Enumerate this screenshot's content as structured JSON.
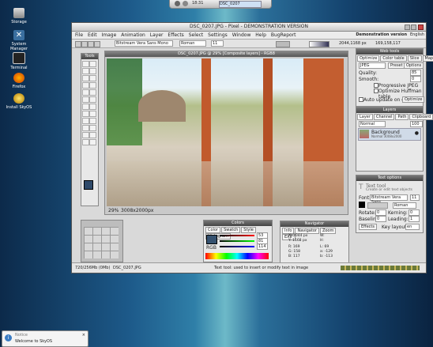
{
  "desktop": {
    "icons": [
      {
        "label": "Storage"
      },
      {
        "label": "System Manager"
      },
      {
        "label": "Terminal"
      },
      {
        "label": "Firefox"
      },
      {
        "label": "Install SkyOS"
      }
    ]
  },
  "dock": {
    "clock": "18:31",
    "task": "DSC_0207"
  },
  "window": {
    "title": "DSC_0207.JPG - Pixel - DEMONSTRATION VERSION",
    "menu": [
      "File",
      "Edit",
      "Image",
      "Animation",
      "Layer",
      "Effects",
      "Select",
      "Settings",
      "Window",
      "Help",
      "BugReport"
    ],
    "demo_label": "Demonstration version",
    "language": "English",
    "font_name": "Bitstream Vera Sans Mono",
    "font_style": "Roman",
    "font_size": "11",
    "coords": "2044,1168 px",
    "color_values": "169,158,117"
  },
  "tools": {
    "title": "Tools"
  },
  "doc": {
    "title": "DSC_0207.JPG @ 29% [Composite layers] - RGB8",
    "zoom": "29%",
    "size": "3008x2000px"
  },
  "colors_panel": {
    "title": "Colors",
    "tabs": [
      "Color",
      "Swatch",
      "Style",
      "Histogram"
    ],
    "r": "53",
    "g": "81",
    "b": "114",
    "mode": "RGB"
  },
  "navigator": {
    "title": "Navigator",
    "tabs": [
      "Info",
      "Navigator",
      "Zoom",
      "EXIF"
    ],
    "x": "X: 2044 px",
    "y": "Y: 1168 px",
    "r": "R: 169",
    "g": "G: 158",
    "b": "B: 117",
    "w": "W:",
    "h": "H:",
    "l": "L: 69",
    "a": "a: -129",
    "bb": "b: -113"
  },
  "webtools": {
    "title": "Web tools",
    "tabs": [
      "Optimize",
      "Color table",
      "Slice",
      "Map"
    ],
    "format": "JPEG",
    "preset": "Preset",
    "options": "Options",
    "quality_label": "Quality:",
    "quality": "85",
    "smooth_label": "Smooth:",
    "smooth": "0",
    "progressive": "Progressive JPEG",
    "huffman": "Optimize Huffman table",
    "auto_update": "Auto update on change",
    "optimize": "Optimize"
  },
  "layers": {
    "title": "Layers",
    "tabs": [
      "Layer",
      "Channel",
      "Path",
      "Clipboard"
    ],
    "mode": "Normal",
    "opacity": "100",
    "layer_name": "Background",
    "layer_info": "Normal 3008x2000"
  },
  "textopts": {
    "title": "Text options",
    "tool_name": "Text tool",
    "tool_desc": "Create or edit text objects",
    "font_label": "Font:",
    "font": "Bitstream Vera Sans",
    "size": "11",
    "style": "Roman",
    "rotate_label": "Rotate:",
    "rotate": "0",
    "kerning_label": "Kerning:",
    "kerning": "0",
    "baseline_label": "Baseline:",
    "baseline": "0",
    "leading_label": "Leading:",
    "leading": "1",
    "effects": "Effects",
    "keylayout_label": "Key layout:",
    "keylayout": "en"
  },
  "status": {
    "mem": "720/256Mb (0Mb)",
    "file": "DSC_0207.JPG",
    "hint": "Text tool: used to insert or modify text in image"
  },
  "notify": {
    "title": "Notice",
    "message": "Welcome to SkyOS"
  }
}
